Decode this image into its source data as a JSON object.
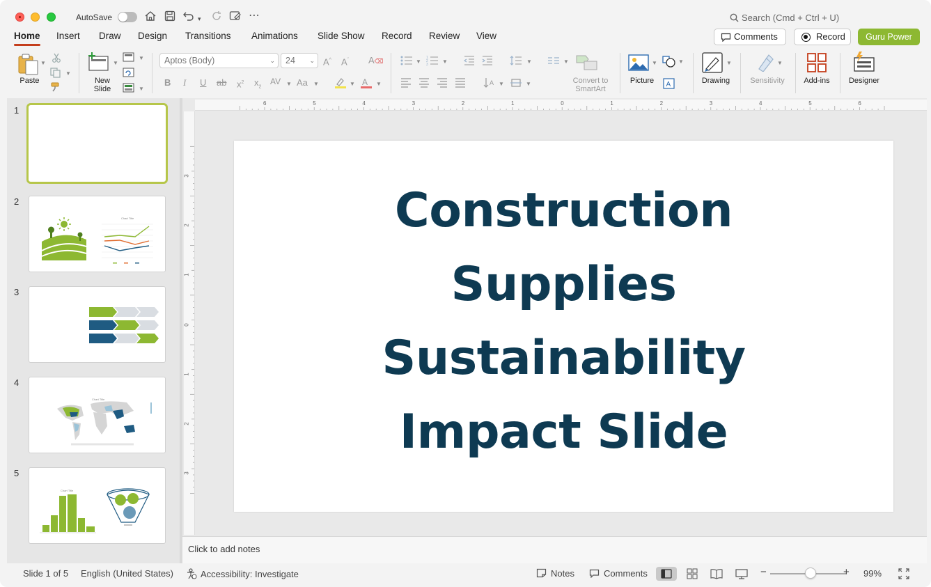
{
  "titlebar": {
    "autosave_label": "AutoSave",
    "search_placeholder": "Search (Cmd + Ctrl + U)"
  },
  "tabs": [
    "Home",
    "Insert",
    "Draw",
    "Design",
    "Transitions",
    "Animations",
    "Slide Show",
    "Record",
    "Review",
    "View"
  ],
  "actions": {
    "comments": "Comments",
    "record": "Record",
    "guru": "Guru Power"
  },
  "ribbon": {
    "paste": "Paste",
    "new_slide_1": "New",
    "new_slide_2": "Slide",
    "font_name": "Aptos (Body)",
    "font_size": "24",
    "convert_1": "Convert to",
    "convert_2": "SmartArt",
    "picture": "Picture",
    "drawing": "Drawing",
    "sensitivity": "Sensitivity",
    "addins": "Add-ins",
    "designer": "Designer"
  },
  "thumbnails": [
    "1",
    "2",
    "3",
    "4",
    "5"
  ],
  "slide": {
    "title_lines": [
      "Construction",
      "Supplies",
      "Sustainability",
      "Impact Slide"
    ]
  },
  "notes_placeholder": "Click to add notes",
  "status": {
    "slide_count": "Slide 1 of 5",
    "language": "English (United States)",
    "accessibility": "Accessibility: Investigate",
    "notes": "Notes",
    "comments": "Comments",
    "zoom": "99%"
  },
  "colors": {
    "accent": "#8db832",
    "title": "#0e3a52",
    "record_tab_underline": "#c43e1c"
  },
  "ruler_h_labels": [
    "6",
    "5",
    "4",
    "3",
    "2",
    "1",
    "0",
    "1",
    "2",
    "3",
    "4",
    "5",
    "6"
  ],
  "ruler_v_labels": [
    "3",
    "2",
    "1",
    "0",
    "1",
    "2",
    "3"
  ]
}
